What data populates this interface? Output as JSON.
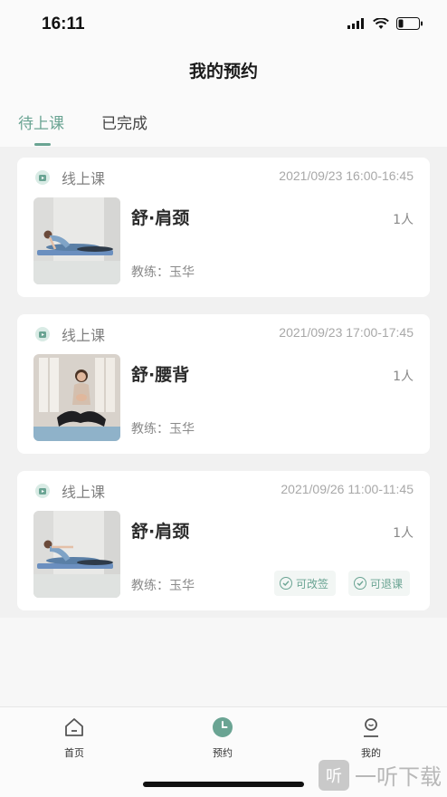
{
  "status_bar": {
    "time": "16:11"
  },
  "header": {
    "title": "我的预约"
  },
  "tabs": [
    {
      "label": "待上课",
      "active": true
    },
    {
      "label": "已完成",
      "active": false
    }
  ],
  "bookings": [
    {
      "type": "线上课",
      "time": "2021/09/23 16:00-16:45",
      "title": "舒·肩颈",
      "count": "1人",
      "coach": "教练：玉华"
    },
    {
      "type": "线上课",
      "time": "2021/09/23 17:00-17:45",
      "title": "舒·腰背",
      "count": "1人",
      "coach": "教练：玉华"
    },
    {
      "type": "线上课",
      "time": "2021/09/26 11:00-11:45",
      "title": "舒·肩颈",
      "count": "1人",
      "coach": "教练：玉华",
      "actions": [
        "可改签",
        "可退课"
      ]
    }
  ],
  "bottom_nav": [
    {
      "label": "首页",
      "icon": "home-icon"
    },
    {
      "label": "预约",
      "icon": "clock-icon",
      "active": true
    },
    {
      "label": "我的",
      "icon": "profile-icon"
    }
  ],
  "watermark": {
    "icon_char": "听",
    "text": "一听下载"
  },
  "colors": {
    "accent": "#6aa493",
    "card_bg": "#ffffff",
    "list_bg": "#f1f1f1"
  }
}
